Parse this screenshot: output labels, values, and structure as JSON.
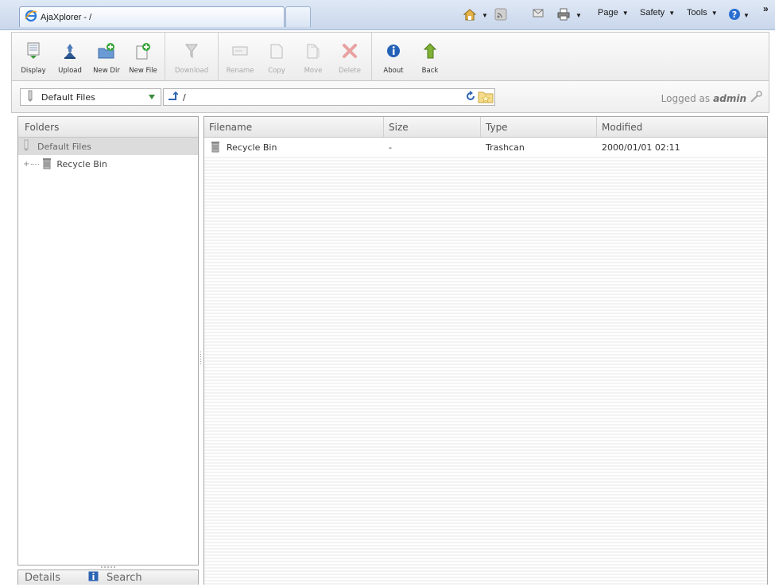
{
  "browser": {
    "tab_title": "AjaXplorer - /",
    "commands": {
      "page": "Page",
      "safety": "Safety",
      "tools": "Tools",
      "more": "»"
    }
  },
  "toolbar": {
    "display": "Display",
    "upload": "Upload",
    "new_dir": "New Dir",
    "new_file": "New File",
    "download": "Download",
    "rename": "Rename",
    "copy": "Copy",
    "move": "Move",
    "delete": "Delete",
    "about": "About",
    "back": "Back"
  },
  "address": {
    "repository": "Default Files",
    "path": "/",
    "logged_prefix": "Logged as",
    "user": "admin"
  },
  "folders_panel": {
    "header": "Folders",
    "root": "Default Files",
    "children": [
      "Recycle Bin"
    ]
  },
  "bottom_tabs": {
    "details": "Details",
    "search": "Search"
  },
  "file_list": {
    "columns": [
      "Filename",
      "Size",
      "Type",
      "Modified"
    ],
    "rows": [
      {
        "filename": "Recycle Bin",
        "size": "-",
        "type": "Trashcan",
        "modified": "2000/01/01 02:11"
      }
    ]
  },
  "colors": {
    "browser_chrome": "#c9d7ec",
    "panel_border": "#a8a8a8",
    "selected_row": "#dcdcdc"
  }
}
